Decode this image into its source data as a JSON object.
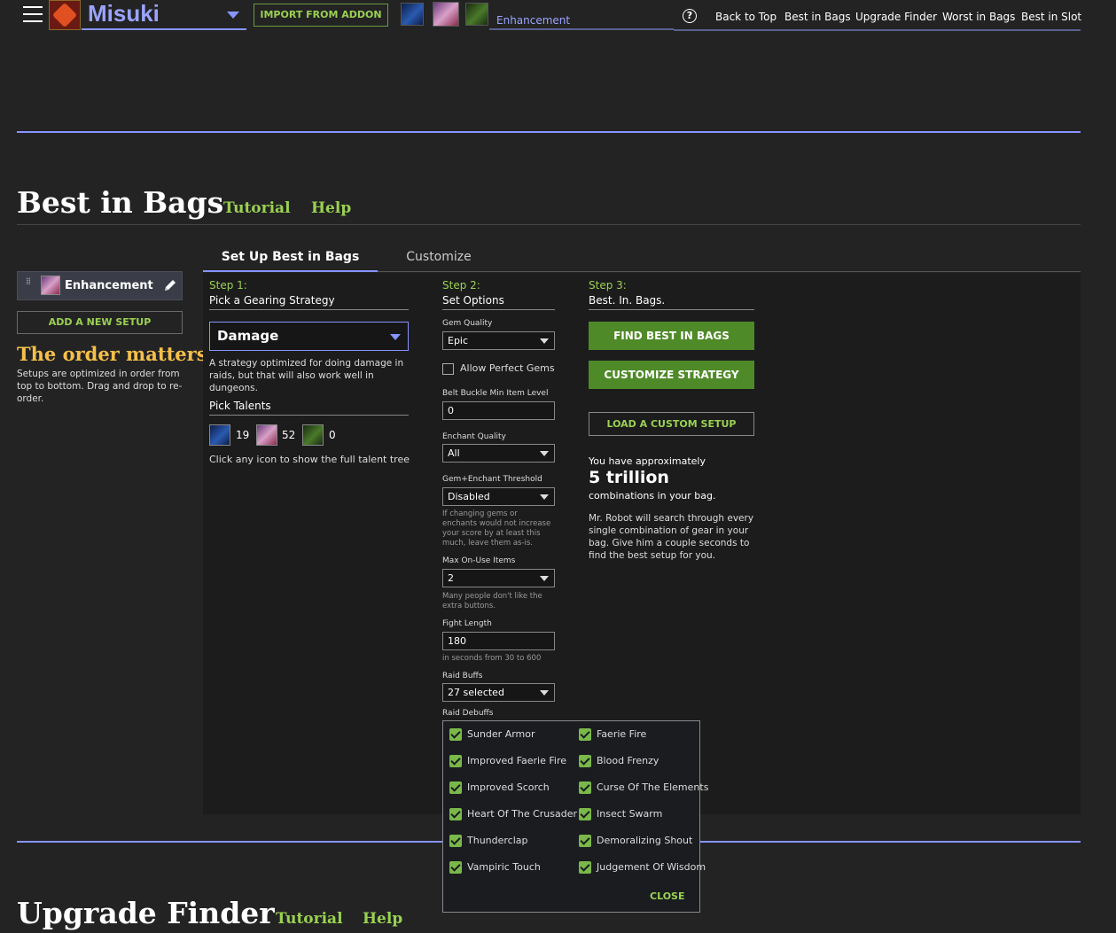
{
  "header": {
    "character_name": "Misuki",
    "import_label": "IMPORT FROM ADDON",
    "spec_label": "Enhancement",
    "help_glyph": "?",
    "nav": [
      "Back to Top",
      "Best in Bags",
      "Upgrade Finder",
      "Worst in Bags",
      "Best in Slot"
    ]
  },
  "best_in_bags": {
    "title": "Best in Bags",
    "tutorial": "Tutorial",
    "help": "Help"
  },
  "setups": {
    "items": [
      {
        "name": "Enhancement"
      }
    ],
    "add_label": "ADD A NEW SETUP",
    "order_title": "The order matters",
    "order_desc": "Setups are optimized in order from top to bottom. Drag and drop to re-order."
  },
  "tabs": {
    "setup": "Set Up Best in Bags",
    "customize": "Customize"
  },
  "step1": {
    "num": "Step 1:",
    "title": "Pick a Gearing Strategy",
    "strategy": "Damage",
    "strategy_desc": "A strategy optimized for doing damage in raids, but that will also work well in dungeons.",
    "talents_title": "Pick Talents",
    "talents": [
      19,
      52,
      0
    ],
    "talent_hint": "Click any icon to show the full talent tree"
  },
  "step2": {
    "num": "Step 2:",
    "title": "Set Options",
    "gem_quality_label": "Gem Quality",
    "gem_quality": "Epic",
    "perfect_gems_label": "Allow Perfect Gems",
    "perfect_gems": false,
    "buckle_label": "Belt Buckle Min Item Level",
    "buckle_value": "0",
    "enchant_label": "Enchant Quality",
    "enchant_value": "All",
    "threshold_label": "Gem+Enchant Threshold",
    "threshold_value": "Disabled",
    "threshold_note": "If changing gems or enchants would not increase your score by at least this much, leave them as-is.",
    "onuse_label": "Max On-Use Items",
    "onuse_value": "2",
    "onuse_note": "Many people don't like the extra buttons.",
    "fight_label": "Fight Length",
    "fight_value": "180",
    "fight_note": "in seconds from 30 to 600",
    "buffs_label": "Raid Buffs",
    "buffs_value": "27 selected",
    "debuffs_label": "Raid Debuffs"
  },
  "step3": {
    "num": "Step 3:",
    "title": "Best. In. Bags.",
    "find_label": "FIND BEST IN BAGS",
    "customize_label": "CUSTOMIZE STRATEGY",
    "load_label": "LOAD A CUSTOM SETUP",
    "combo_pre": "You have approximately",
    "combo_num": "5 trillion",
    "combo_post": "combinations in your bag.",
    "robot_desc": "Mr. Robot will search through every single combination of gear in your bag. Give him a couple seconds to find the best setup for you."
  },
  "debuffs": {
    "left": [
      "Sunder Armor",
      "Improved Faerie Fire",
      "Improved Scorch",
      "Heart Of The Crusader",
      "Thunderclap",
      "Vampiric Touch"
    ],
    "right": [
      "Faerie Fire",
      "Blood Frenzy",
      "Curse Of The Elements",
      "Insect Swarm",
      "Demoralizing Shout",
      "Judgement Of Wisdom"
    ],
    "close": "CLOSE"
  },
  "upgrade_finder": {
    "title": "Upgrade Finder",
    "tutorial": "Tutorial",
    "help": "Help"
  },
  "colors": {
    "background": "#232323",
    "accent": "#8794ff",
    "green": "#9ad152",
    "button_green": "#4f8a28",
    "gold": "#f5c04a"
  }
}
